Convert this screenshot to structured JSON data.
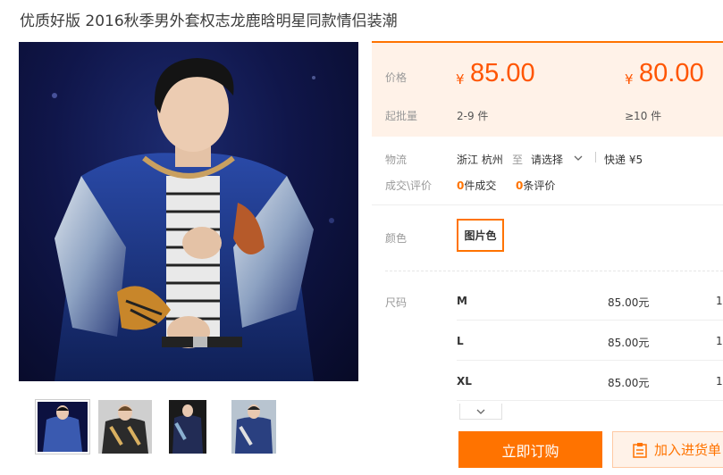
{
  "product": {
    "title": "优质好版 2016秋季男外套权志龙鹿晗明星同款情侣装潮"
  },
  "gallery": {
    "thumbnail_count": 4,
    "selected_index": 0
  },
  "price_panel": {
    "price_label": "价格",
    "moq_label": "起批量",
    "tiers": [
      {
        "currency": "¥",
        "price": "85.00",
        "range": "2-9 件"
      },
      {
        "currency": "¥",
        "price": "80.00",
        "range": "≥10 件"
      }
    ]
  },
  "logistics": {
    "label": "物流",
    "origin": "浙江 杭州",
    "to": "至",
    "destination": "请选择",
    "shipping": "快递 ¥5"
  },
  "transactions": {
    "label": "成交\\评价",
    "deals_count": "0",
    "deals_text": "件成交",
    "reviews_count": "0",
    "reviews_text": "条评价"
  },
  "color": {
    "label": "颜色",
    "selected": "图片色"
  },
  "size": {
    "label": "尺码",
    "rows": [
      {
        "name": "M",
        "price": "85.00元",
        "stock": "1"
      },
      {
        "name": "L",
        "price": "85.00元",
        "stock": "1"
      },
      {
        "name": "XL",
        "price": "85.00元",
        "stock": "1"
      }
    ]
  },
  "actions": {
    "buy_label": "立即订购",
    "cart_label": "加入进货单"
  },
  "colors": {
    "accent": "#ff7300",
    "price": "#ff5500",
    "panel_bg": "#fff2e8"
  }
}
